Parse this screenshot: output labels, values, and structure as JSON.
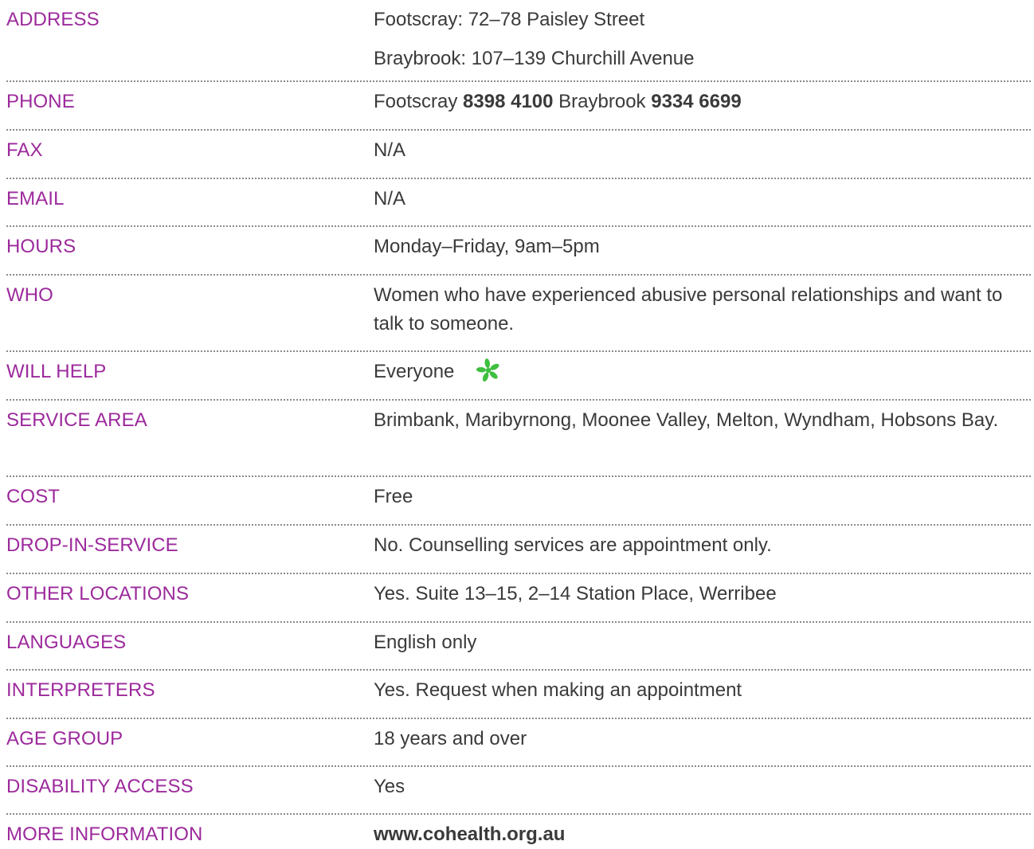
{
  "colors": {
    "label": "#9c2a9c",
    "value": "#3a3a3a",
    "icon": "#3fbf3f",
    "rule": "#8a8a8a"
  },
  "rows": [
    {
      "label": "ADDRESS",
      "lines": [
        "Footscray: 72–78 Paisley Street",
        "Braybrook: 107–139 Churchill Avenue"
      ]
    },
    {
      "label": "PHONE",
      "parts": [
        {
          "text": "Footscray",
          "bold": false
        },
        {
          "text": "8398 4100",
          "bold": true
        },
        {
          "text": "Braybrook",
          "bold": false
        },
        {
          "text": "9334 6699",
          "bold": true
        }
      ]
    },
    {
      "label": "FAX",
      "value": "N/A"
    },
    {
      "label": "EMAIL",
      "value": "N/A"
    },
    {
      "label": "HOURS",
      "value": "Monday–Friday, 9am–5pm"
    },
    {
      "label": "WHO",
      "value": "Women who have experienced abusive personal relationships and want to talk to someone."
    },
    {
      "label": "WILL HELP",
      "value": "Everyone",
      "icon": "green-asterisk-icon"
    },
    {
      "label": "SERVICE AREA",
      "value": "Brimbank, Maribyrnong, Moonee Valley, Melton, Wyndham, Hobsons Bay."
    },
    {
      "label": "COST",
      "value": "Free"
    },
    {
      "label": "DROP-IN-SERVICE",
      "value": "No. Counselling services are appointment only."
    },
    {
      "label": "OTHER LOCATIONS",
      "value": "Yes. Suite 13–15, 2–14 Station Place, Werribee"
    },
    {
      "label": "LANGUAGES",
      "value": "English only"
    },
    {
      "label": "INTERPRETERS",
      "value": "Yes. Request when making an appointment"
    },
    {
      "label": "AGE GROUP",
      "value": "18 years and over"
    },
    {
      "label": "DISABILITY ACCESS",
      "value": "Yes"
    },
    {
      "label": "MORE INFORMATION",
      "value": "www.cohealth.org.au"
    }
  ]
}
